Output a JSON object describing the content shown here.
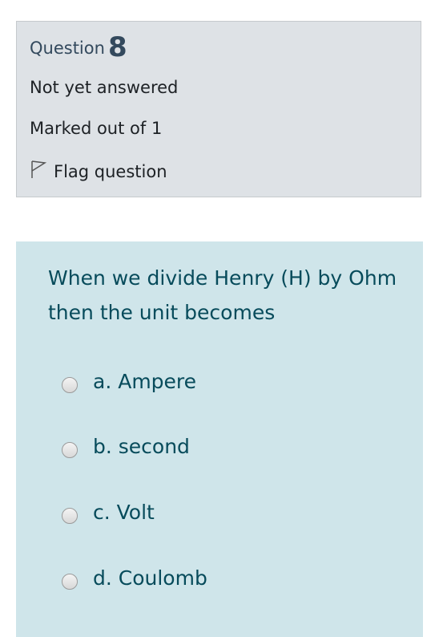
{
  "info": {
    "question_label": "Question",
    "question_number": "8",
    "state": "Not yet answered",
    "grade": "Marked out of 1",
    "flag_label": "Flag question"
  },
  "question": {
    "text": "When we divide Henry (H) by Ohm  then the unit becomes",
    "answers": [
      {
        "label": "a. Ampere",
        "selected": false
      },
      {
        "label": "b. second",
        "selected": false
      },
      {
        "label": "c. Volt",
        "selected": false
      },
      {
        "label": "d. Coulomb",
        "selected": false
      }
    ]
  },
  "colors": {
    "info_background": "#dee2e6",
    "formulation_background": "#cfe5ea",
    "question_text": "#074b5b"
  },
  "icons": {
    "flag": "flag-icon"
  }
}
